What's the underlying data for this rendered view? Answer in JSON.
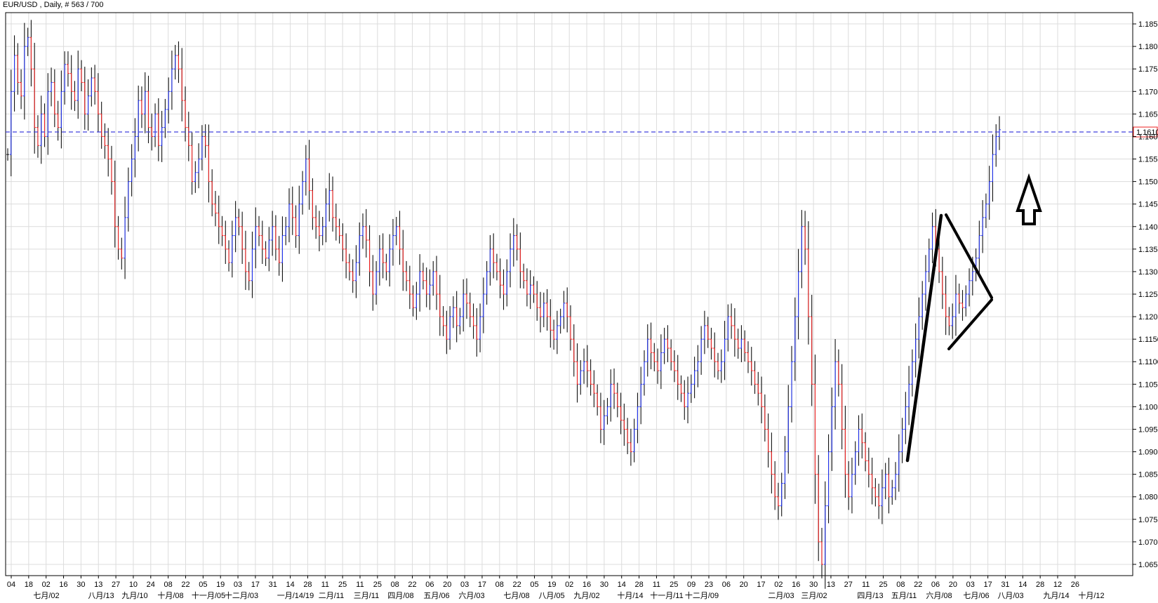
{
  "header": {
    "title": "EUR/USD , Daily, # 563 / 700"
  },
  "colors": {
    "up": "#2233ee",
    "down": "#ee2222",
    "neutral": "#111111",
    "grid": "#dcdcdc",
    "price_line": "#4040dd"
  },
  "chart_data": {
    "type": "ohlc-bar",
    "symbol": "EUR/USD",
    "timeframe": "Daily",
    "ylim": [
      1.0625,
      1.1875
    ],
    "y_ticks": [
      "1.1850",
      "1.1800",
      "1.1750",
      "1.1700",
      "1.1650",
      "1.1600",
      "1.1550",
      "1.1500",
      "1.1450",
      "1.1400",
      "1.1350",
      "1.1300",
      "1.1250",
      "1.1200",
      "1.1150",
      "1.1100",
      "1.1050",
      "1.1000",
      "1.0950",
      "1.0900",
      "1.0850",
      "1.0800",
      "1.0750",
      "1.0700",
      "1.0650"
    ],
    "current_price": "1.1610",
    "x_day_labels": [
      "04",
      "18",
      "02",
      "16",
      "30",
      "13",
      "27",
      "10",
      "24",
      "08",
      "22",
      "05",
      "19",
      "03",
      "17",
      "31",
      "14",
      "28",
      "11",
      "25",
      "11",
      "25",
      "08",
      "22",
      "06",
      "20",
      "03",
      "17",
      "08",
      "22",
      "05",
      "19",
      "02",
      "16",
      "30",
      "14",
      "28",
      "11",
      "25",
      "09",
      "23",
      "06",
      "20",
      "17",
      "02",
      "16",
      "30",
      "13",
      "27",
      "11",
      "25",
      "08",
      "22",
      "06",
      "20",
      "03",
      "17",
      "31",
      "14",
      "28",
      "12",
      "26"
    ],
    "x_month_labels": [
      "七月/02",
      "八月/13",
      "九月/10",
      "十月/08",
      "十一月/05",
      "十二月/03",
      "一月/14/19",
      "二月/11",
      "三月/11",
      "四月/08",
      "五月/06",
      "六月/03",
      "七月/08",
      "八月/05",
      "九月/02",
      "十月/14",
      "十一月/11",
      "十二月/09",
      "二月/03",
      "三月/02",
      "四月/13",
      "五月/11",
      "六月/08",
      "七月/06",
      "八月/03",
      "九月/14",
      "十月/12"
    ],
    "series": [
      {
        "values": [
          1.156,
          1.17,
          1.178,
          1.172,
          1.169,
          1.18,
          1.182,
          1.175,
          1.162,
          1.158,
          1.165,
          1.16,
          1.17,
          1.172,
          1.165,
          1.162,
          1.17,
          1.176,
          1.174,
          1.17,
          1.168,
          1.175,
          1.172,
          1.165,
          1.169,
          1.173,
          1.17,
          1.165,
          1.16,
          1.158,
          1.155,
          1.15,
          1.14,
          1.135,
          1.133,
          1.142,
          1.15,
          1.155,
          1.16,
          1.168,
          1.165,
          1.17,
          1.162,
          1.16,
          1.165,
          1.158,
          1.162,
          1.166,
          1.17,
          1.175,
          1.178,
          1.175,
          1.168,
          1.162,
          1.158,
          1.15,
          1.152,
          1.155,
          1.16,
          1.158,
          1.15,
          1.145,
          1.143,
          1.14,
          1.138,
          1.135,
          1.132,
          1.138,
          1.142,
          1.14,
          1.135,
          1.13,
          1.128,
          1.135,
          1.14,
          1.138,
          1.135,
          1.133,
          1.137,
          1.14,
          1.135,
          1.132,
          1.138,
          1.14,
          1.145,
          1.142,
          1.138,
          1.145,
          1.15,
          1.155,
          1.148,
          1.142,
          1.14,
          1.138,
          1.14,
          1.145,
          1.148,
          1.142,
          1.14,
          1.138,
          1.135,
          1.132,
          1.13,
          1.128,
          1.132,
          1.138,
          1.14,
          1.137,
          1.13,
          1.125,
          1.13,
          1.135,
          1.132,
          1.13,
          1.135,
          1.138,
          1.14,
          1.135,
          1.13,
          1.128,
          1.125,
          1.122,
          1.125,
          1.13,
          1.128,
          1.125,
          1.127,
          1.13,
          1.125,
          1.12,
          1.118,
          1.115,
          1.12,
          1.122,
          1.118,
          1.12,
          1.125,
          1.123,
          1.12,
          1.118,
          1.115,
          1.12,
          1.125,
          1.13,
          1.135,
          1.132,
          1.13,
          1.127,
          1.125,
          1.13,
          1.135,
          1.138,
          1.135,
          1.13,
          1.128,
          1.125,
          1.127,
          1.125,
          1.122,
          1.12,
          1.123,
          1.12,
          1.117,
          1.115,
          1.118,
          1.12,
          1.123,
          1.12,
          1.115,
          1.11,
          1.105,
          1.108,
          1.11,
          1.108,
          1.105,
          1.103,
          1.1,
          1.095,
          1.098,
          1.1,
          1.105,
          1.103,
          1.1,
          1.097,
          1.095,
          1.092,
          1.09,
          1.095,
          1.1,
          1.105,
          1.11,
          1.115,
          1.112,
          1.11,
          1.108,
          1.112,
          1.115,
          1.113,
          1.11,
          1.108,
          1.105,
          1.103,
          1.1,
          1.103,
          1.105,
          1.108,
          1.11,
          1.115,
          1.118,
          1.115,
          1.113,
          1.11,
          1.108,
          1.11,
          1.115,
          1.12,
          1.118,
          1.115,
          1.113,
          1.115,
          1.112,
          1.11,
          1.108,
          1.105,
          1.103,
          1.1,
          1.095,
          1.09,
          1.085,
          1.08,
          1.078,
          1.083,
          1.09,
          1.1,
          1.11,
          1.12,
          1.13,
          1.14,
          1.135,
          1.12,
          1.105,
          1.085,
          1.07,
          1.065,
          1.078,
          1.09,
          1.1,
          1.11,
          1.105,
          1.095,
          1.085,
          1.08,
          1.085,
          1.09,
          1.095,
          1.092,
          1.088,
          1.085,
          1.082,
          1.08,
          1.078,
          1.082,
          1.085,
          1.08,
          1.082,
          1.085,
          1.09,
          1.095,
          1.1,
          1.105,
          1.11,
          1.115,
          1.12,
          1.125,
          1.13,
          1.135,
          1.14,
          1.135,
          1.13,
          1.125,
          1.12,
          1.118,
          1.12,
          1.125,
          1.123,
          1.122,
          1.125,
          1.128,
          1.13,
          1.133,
          1.138,
          1.142,
          1.145,
          1.15,
          1.156,
          1.16,
          1.1615
        ]
      }
    ]
  }
}
